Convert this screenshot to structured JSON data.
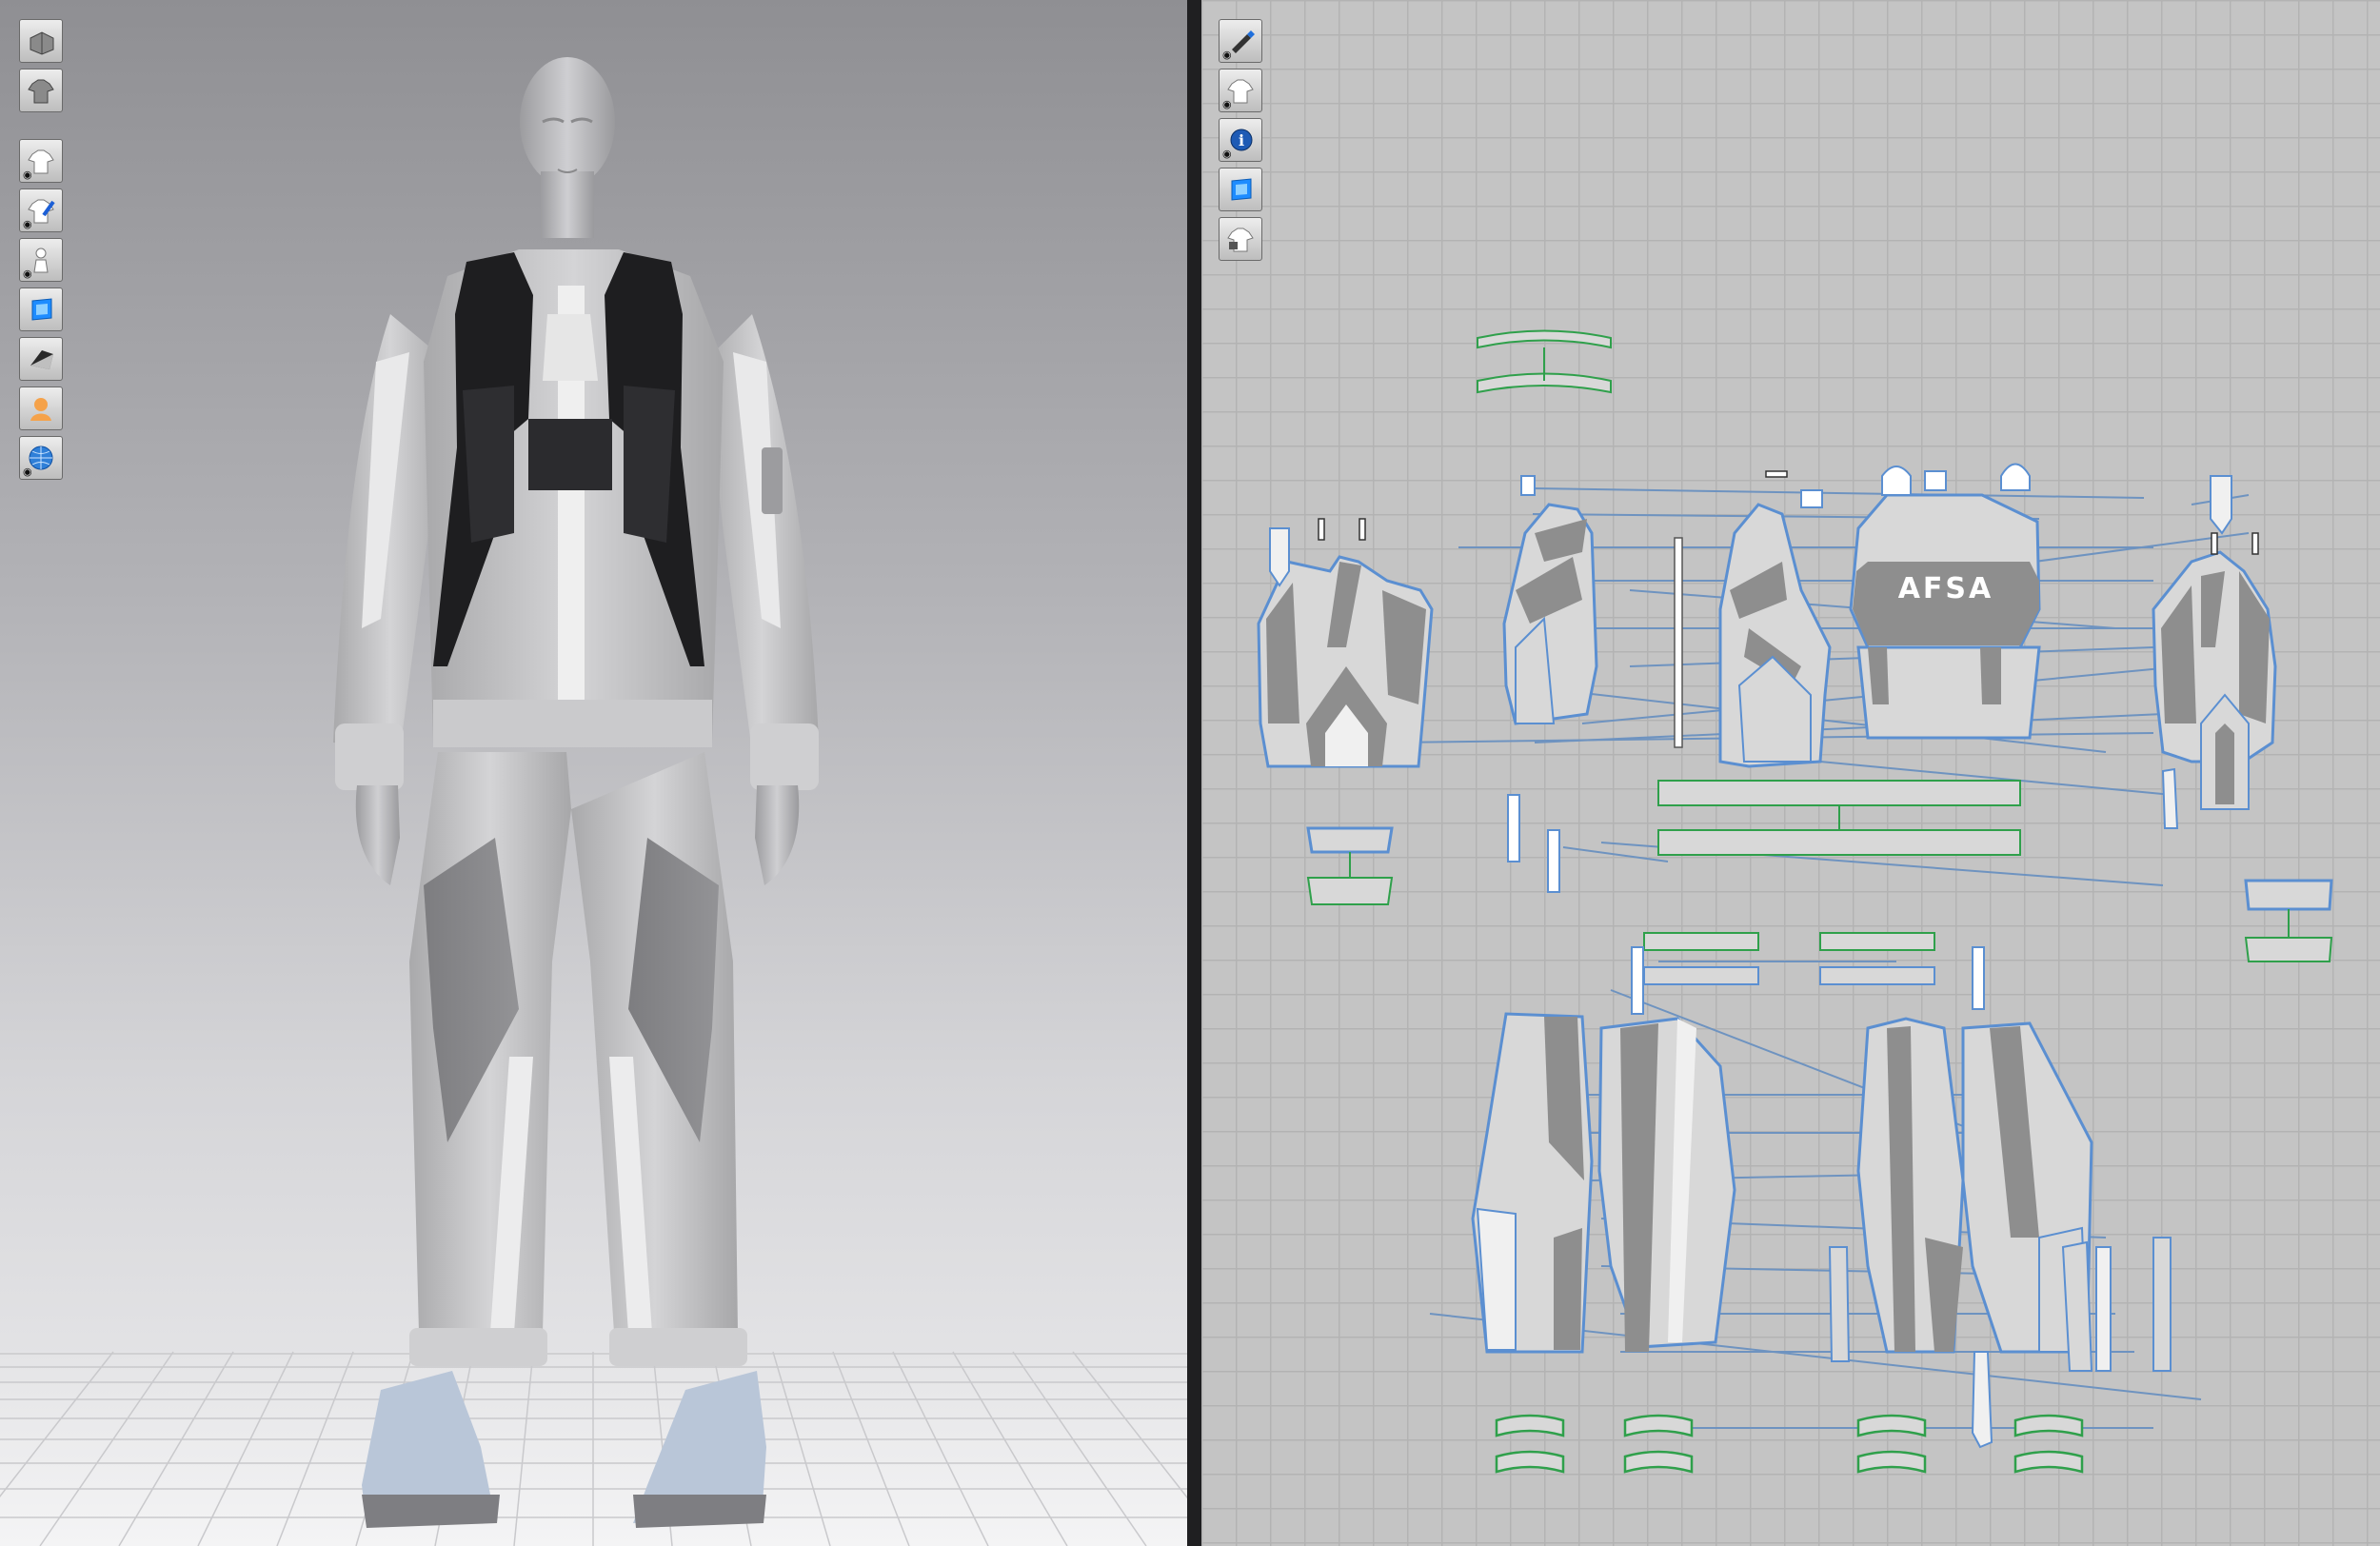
{
  "left_panel": {
    "view": "3D garment window",
    "toolbar": [
      {
        "icon": "box-view-icon",
        "label": ""
      },
      {
        "icon": "garment-shirt-icon",
        "label": ""
      },
      {
        "icon": "show-garment-icon",
        "label": ""
      },
      {
        "icon": "show-pins-icon",
        "label": ""
      },
      {
        "icon": "show-avatar-icon",
        "label": ""
      },
      {
        "icon": "texture-fabric-icon",
        "label": ""
      },
      {
        "icon": "shaded-view-icon",
        "label": ""
      },
      {
        "icon": "avatar-skin-icon",
        "label": ""
      },
      {
        "icon": "environment-globe-icon",
        "label": ""
      }
    ]
  },
  "right_panel": {
    "view": "2D pattern window",
    "toolbar": [
      {
        "icon": "pen-tool-icon"
      },
      {
        "icon": "shirt-visibility-icon"
      },
      {
        "icon": "info-icon"
      },
      {
        "icon": "fabric-texture-icon"
      },
      {
        "icon": "lock-shirt-icon"
      }
    ],
    "pattern_logo_text": "AFSA"
  },
  "colors": {
    "pattern_outline": "#5b8fd1",
    "pattern_fill_light": "#d8d8d8",
    "pattern_fill_dark": "#8e8e8e",
    "trim_green": "#2fa04b",
    "seam_line": "#6e93c0",
    "vest_black": "#1e1e20"
  }
}
